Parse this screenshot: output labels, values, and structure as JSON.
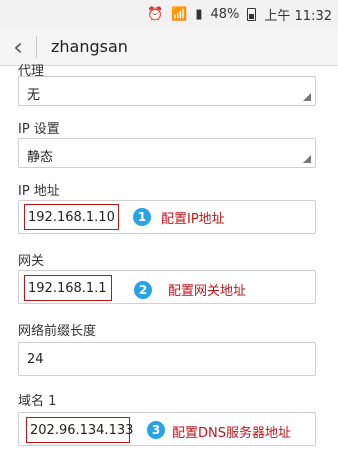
{
  "status_bar": {
    "battery": "48%",
    "time": "上午 11:32"
  },
  "app_bar": {
    "title": "zhangsan"
  },
  "proxy": {
    "label_partial": "代理",
    "value": "无"
  },
  "ip_settings": {
    "label": "IP 设置",
    "value": "静态"
  },
  "ip_address": {
    "label": "IP 地址",
    "value": "192.168.1.10",
    "step": "1",
    "annotation": "配置IP地址"
  },
  "gateway": {
    "label": "网关",
    "value": "192.168.1.1",
    "step": "2",
    "annotation": "配置网关地址"
  },
  "prefix_length": {
    "label": "网络前缀长度",
    "value": "24"
  },
  "dns1": {
    "label": "域名 1",
    "value": "202.96.134.133",
    "step": "3",
    "annotation": "配置DNS服务器地址"
  },
  "colors": {
    "annotation_red": "#c0141b",
    "badge_blue": "#29a3e3"
  }
}
